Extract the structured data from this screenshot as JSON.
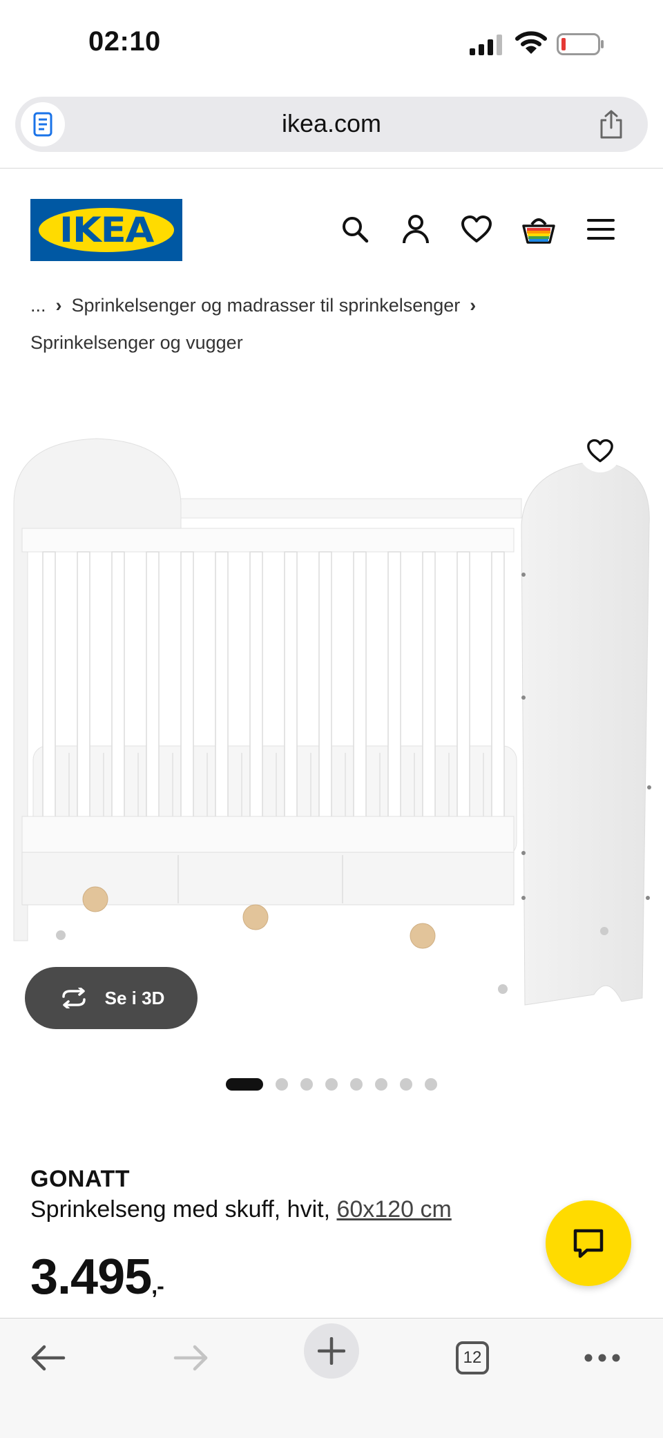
{
  "status_bar": {
    "time": "02:10"
  },
  "browser": {
    "url": "ikea.com",
    "tab_count": "12"
  },
  "header": {
    "logo_text": "IKEA"
  },
  "breadcrumb": {
    "items": [
      "...",
      "Sprinkelsenger og madrasser til sprinkelsenger",
      "Sprinkelsenger og vugger"
    ]
  },
  "gallery": {
    "view_3d_label": "Se i 3D",
    "image_count": 8,
    "active_index": 0
  },
  "product": {
    "name": "GONATT",
    "description": "Sprinkelseng med skuff, hvit,",
    "size": "60x120 cm",
    "price": "3.495",
    "price_suffix": ",-"
  },
  "colors": {
    "ikea_blue": "#0058a3",
    "ikea_yellow": "#ffdb00",
    "battery_low": "#e53935"
  }
}
